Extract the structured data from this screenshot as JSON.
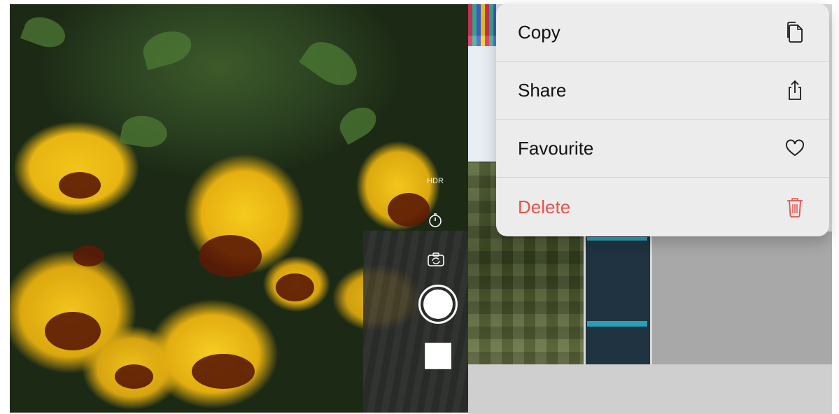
{
  "camera": {
    "hdr_label": "HDR",
    "icons": [
      "timer-icon",
      "camera-flip-icon",
      "shutter-button",
      "last-photo-thumbnail"
    ]
  },
  "context_menu": {
    "items": [
      {
        "label": "Copy",
        "icon": "copy-icon",
        "color": "#111111"
      },
      {
        "label": "Share",
        "icon": "share-icon",
        "color": "#111111"
      },
      {
        "label": "Favourite",
        "icon": "heart-icon",
        "color": "#111111"
      },
      {
        "label": "Delete",
        "icon": "trash-icon",
        "color": "#e5534b"
      }
    ]
  },
  "colors": {
    "destructive": "#e5534b",
    "menu_background": "#ececec"
  }
}
